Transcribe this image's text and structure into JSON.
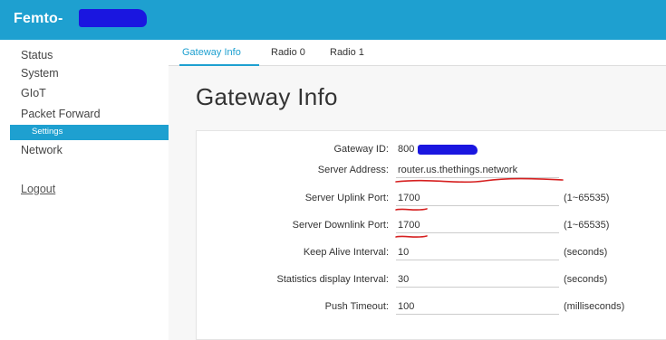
{
  "header": {
    "brand": "Femto-"
  },
  "sidebar": {
    "items": [
      {
        "label": "Status"
      },
      {
        "label": "System"
      },
      {
        "label": "GIoT"
      },
      {
        "label": "Packet Forward"
      },
      {
        "label": "Settings",
        "active": true
      },
      {
        "label": "Network"
      },
      {
        "label": "Logout"
      }
    ]
  },
  "tabs": [
    {
      "label": "Gateway Info",
      "active": true
    },
    {
      "label": "Radio 0"
    },
    {
      "label": "Radio 1"
    }
  ],
  "page": {
    "title": "Gateway Info"
  },
  "form": {
    "rows": [
      {
        "label": "Gateway ID:",
        "value": "800",
        "unit": ""
      },
      {
        "label": "Server Address:",
        "value": "router.us.thethings.network",
        "unit": ""
      },
      {
        "label": "Server Uplink Port:",
        "value": "1700",
        "unit": "(1~65535)"
      },
      {
        "label": "Server Downlink Port:",
        "value": "1700",
        "unit": "(1~65535)"
      },
      {
        "label": "Keep Alive Interval:",
        "value": "10",
        "unit": "(seconds)"
      },
      {
        "label": "Statistics display Interval:",
        "value": "30",
        "unit": "(seconds)"
      },
      {
        "label": "Push Timeout:",
        "value": "100",
        "unit": "(milliseconds)"
      }
    ]
  },
  "colors": {
    "accent": "#1ea0d0",
    "redaction": "#1a16e0",
    "annotation": "#d62020"
  }
}
